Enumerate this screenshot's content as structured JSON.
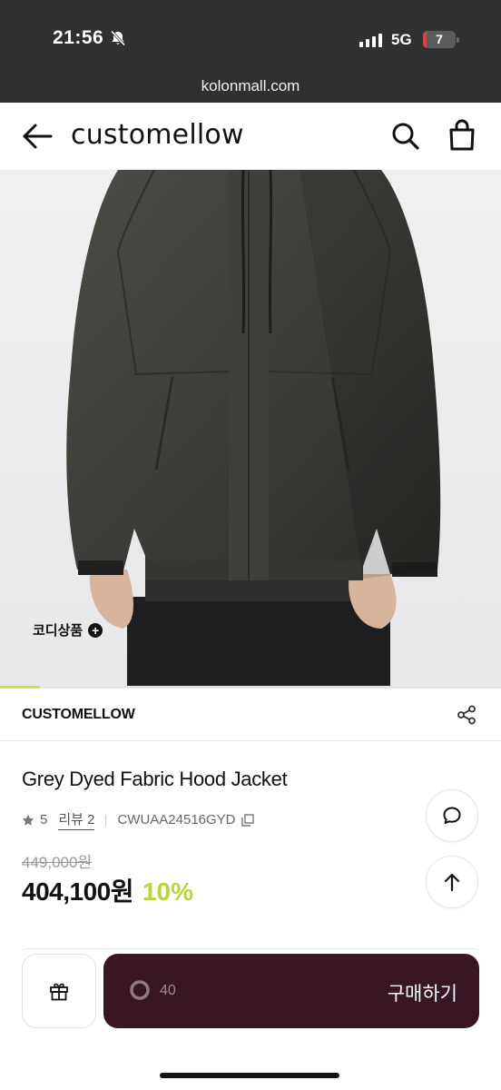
{
  "status_bar": {
    "time": "21:56",
    "network": "5G",
    "battery": "7",
    "battery_level": 0.07,
    "icons": [
      "bell-slash-icon",
      "signal-icon",
      "battery-icon"
    ]
  },
  "browser": {
    "url": "kolonmall.com"
  },
  "header": {
    "logo": "customellow",
    "icons": [
      "arrow-left-icon",
      "search-icon",
      "shopping-bag-icon"
    ]
  },
  "hero": {
    "coord_label": "코디상품",
    "image_progress": 0.08,
    "icons": [
      "plus-circle-icon"
    ]
  },
  "brand": {
    "name": "CUSTOMELLOW",
    "icons": [
      "share-icon"
    ]
  },
  "product": {
    "title": "Grey Dyed Fabric Hood Jacket",
    "rating": "5",
    "review_label": "리뷰 2",
    "code": "CWUAA24516GYD",
    "original_price": "449,000원",
    "price": "404,100원",
    "discount": "10%",
    "icons": [
      "star-icon",
      "copy-icon",
      "chat-bubble-icon",
      "arrow-up-icon"
    ]
  },
  "purchase_bar": {
    "count": "40",
    "buy_label": "구매하기",
    "icons": [
      "gift-icon",
      "loading-ring-icon"
    ]
  },
  "colors": {
    "top_bar": "#2f3031",
    "accent_green": "#b6d63a",
    "buy_button": "#3a1624",
    "battery_low": "#e0403c"
  }
}
